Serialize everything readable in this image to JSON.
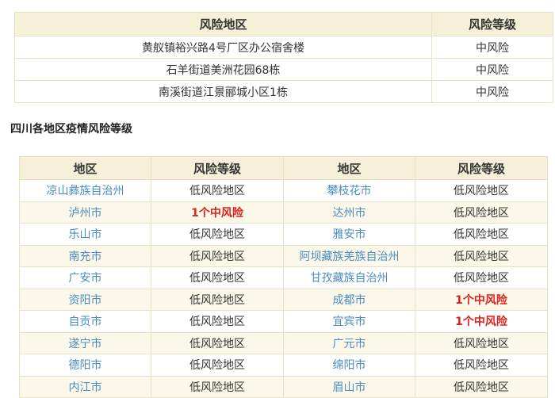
{
  "top_table": {
    "headers": [
      "风险地区",
      "风险等级"
    ],
    "rows": [
      {
        "area": "黄舣镇裕兴路4号厂区办公宿舍楼",
        "level": "中风险"
      },
      {
        "area": "石羊街道美洲花园68栋",
        "level": "中风险"
      },
      {
        "area": "南溪街道江景郦城小区1栋",
        "level": "中风险"
      }
    ]
  },
  "section_heading": "四川各地区疫情风险等级",
  "sichuan_table": {
    "headers": [
      "地区",
      "风险等级",
      "地区",
      "风险等级"
    ],
    "rows": [
      {
        "region_a": "凉山彝族自治州",
        "level_a": "低风险地区",
        "region_b": "攀枝花市",
        "level_b": "低风险地区"
      },
      {
        "region_a": "泸州市",
        "level_a": "1个中风险",
        "region_b": "达州市",
        "level_b": "低风险地区"
      },
      {
        "region_a": "乐山市",
        "level_a": "低风险地区",
        "region_b": "雅安市",
        "level_b": "低风险地区"
      },
      {
        "region_a": "南充市",
        "level_a": "低风险地区",
        "region_b": "阿坝藏族羌族自治州",
        "level_b": "低风险地区"
      },
      {
        "region_a": "广安市",
        "level_a": "低风险地区",
        "region_b": "甘孜藏族自治州",
        "level_b": "低风险地区"
      },
      {
        "region_a": "资阳市",
        "level_a": "低风险地区",
        "region_b": "成都市",
        "level_b": "1个中风险"
      },
      {
        "region_a": "自贡市",
        "level_a": "低风险地区",
        "region_b": "宜宾市",
        "level_b": "1个中风险"
      },
      {
        "region_a": "遂宁市",
        "level_a": "低风险地区",
        "region_b": "广元市",
        "level_b": "低风险地区"
      },
      {
        "region_a": "德阳市",
        "level_a": "低风险地区",
        "region_b": "绵阳市",
        "level_b": "低风险地区"
      },
      {
        "region_a": "内江市",
        "level_a": "低风险地区",
        "region_b": "眉山市",
        "level_b": "低风险地区"
      }
    ]
  },
  "colors": {
    "header_bg": "#f5f0d7",
    "link_blue": "#4a8cc2",
    "medium_risk_red": "#e0201a"
  }
}
